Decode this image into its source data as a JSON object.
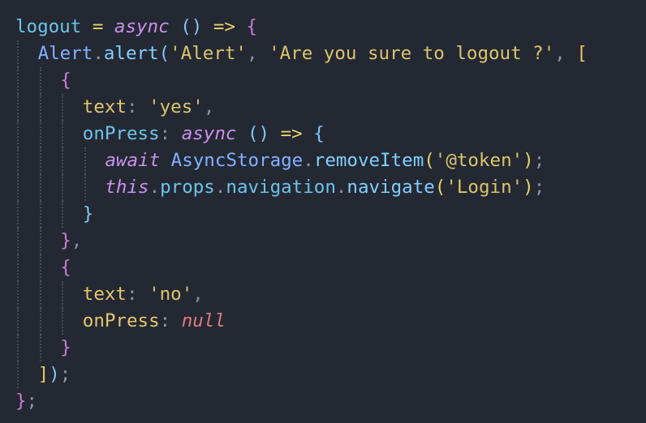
{
  "editor": {
    "language": "javascript",
    "lines": [
      {
        "indent": 0,
        "tokens": [
          {
            "text": "logout",
            "role": "var"
          },
          {
            "text": " = ",
            "role": "op"
          },
          {
            "text": "async",
            "role": "kw",
            "italic": true
          },
          {
            "text": " ",
            "role": "punct"
          },
          {
            "text": "()",
            "role": "paren"
          },
          {
            "text": " => ",
            "role": "op"
          },
          {
            "text": "{",
            "role": "brace1"
          }
        ]
      },
      {
        "indent": 1,
        "tokens": [
          {
            "text": "Alert",
            "role": "class"
          },
          {
            "text": ".",
            "role": "punct"
          },
          {
            "text": "alert",
            "role": "method"
          },
          {
            "text": "(",
            "role": "paren"
          },
          {
            "text": "'Alert'",
            "role": "str"
          },
          {
            "text": ", ",
            "role": "punct"
          },
          {
            "text": "'Are you sure to logout ?'",
            "role": "str"
          },
          {
            "text": ", ",
            "role": "punct"
          },
          {
            "text": "[",
            "role": "bracket"
          }
        ]
      },
      {
        "indent": 2,
        "tokens": [
          {
            "text": "{",
            "role": "brace1"
          }
        ]
      },
      {
        "indent": 3,
        "tokens": [
          {
            "text": "text",
            "role": "prop"
          },
          {
            "text": ": ",
            "role": "punct"
          },
          {
            "text": "'yes'",
            "role": "str"
          },
          {
            "text": ",",
            "role": "punct"
          }
        ]
      },
      {
        "indent": 3,
        "tokens": [
          {
            "text": "onPress",
            "role": "var"
          },
          {
            "text": ": ",
            "role": "punct"
          },
          {
            "text": "async",
            "role": "kw",
            "italic": true
          },
          {
            "text": " ",
            "role": "punct"
          },
          {
            "text": "()",
            "role": "paren"
          },
          {
            "text": " => ",
            "role": "op"
          },
          {
            "text": "{",
            "role": "brace2"
          }
        ]
      },
      {
        "indent": 4,
        "tokens": [
          {
            "text": "await",
            "role": "kw",
            "italic": true
          },
          {
            "text": " ",
            "role": "punct"
          },
          {
            "text": "AsyncStorage",
            "role": "class"
          },
          {
            "text": ".",
            "role": "punct"
          },
          {
            "text": "removeItem",
            "role": "method"
          },
          {
            "text": "(",
            "role": "op"
          },
          {
            "text": "'@token'",
            "role": "str"
          },
          {
            "text": ")",
            "role": "op"
          },
          {
            "text": ";",
            "role": "punct"
          }
        ]
      },
      {
        "indent": 4,
        "tokens": [
          {
            "text": "this",
            "role": "this",
            "italic": true
          },
          {
            "text": ".",
            "role": "punct"
          },
          {
            "text": "props",
            "role": "var"
          },
          {
            "text": ".",
            "role": "punct"
          },
          {
            "text": "navigation",
            "role": "var"
          },
          {
            "text": ".",
            "role": "punct"
          },
          {
            "text": "navigate",
            "role": "method"
          },
          {
            "text": "(",
            "role": "op"
          },
          {
            "text": "'Login'",
            "role": "str"
          },
          {
            "text": ")",
            "role": "op"
          },
          {
            "text": ";",
            "role": "punct"
          }
        ]
      },
      {
        "indent": 3,
        "tokens": [
          {
            "text": "}",
            "role": "brace2"
          }
        ]
      },
      {
        "indent": 2,
        "tokens": [
          {
            "text": "}",
            "role": "brace1"
          },
          {
            "text": ",",
            "role": "punct"
          }
        ]
      },
      {
        "indent": 2,
        "tokens": [
          {
            "text": "{",
            "role": "brace1"
          }
        ]
      },
      {
        "indent": 3,
        "tokens": [
          {
            "text": "text",
            "role": "prop"
          },
          {
            "text": ": ",
            "role": "punct"
          },
          {
            "text": "'no'",
            "role": "str"
          },
          {
            "text": ",",
            "role": "punct"
          }
        ]
      },
      {
        "indent": 3,
        "tokens": [
          {
            "text": "onPress",
            "role": "prop"
          },
          {
            "text": ": ",
            "role": "punct"
          },
          {
            "text": "null",
            "role": "null",
            "italic": true
          }
        ]
      },
      {
        "indent": 2,
        "tokens": [
          {
            "text": "}",
            "role": "brace1"
          }
        ]
      },
      {
        "indent": 1,
        "tokens": [
          {
            "text": "]",
            "role": "bracket"
          },
          {
            "text": ")",
            "role": "paren"
          },
          {
            "text": ";",
            "role": "punct"
          }
        ]
      },
      {
        "indent": 0,
        "tokens": [
          {
            "text": "}",
            "role": "brace1"
          },
          {
            "text": ";",
            "role": "punct"
          }
        ]
      }
    ]
  },
  "colors": {
    "background": "#242833",
    "indent_guide": "#454b57"
  }
}
